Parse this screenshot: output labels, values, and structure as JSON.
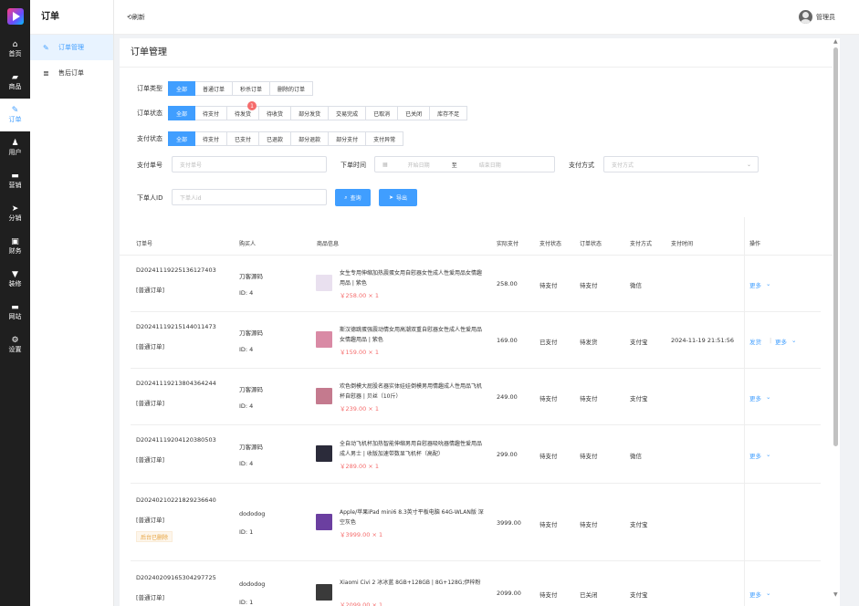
{
  "nav": {
    "items": [
      {
        "icon": "home-icon",
        "glyph": "⌂",
        "label": "首页"
      },
      {
        "icon": "shop-icon",
        "glyph": "▰",
        "label": "商品"
      },
      {
        "icon": "order-icon",
        "glyph": "✎",
        "label": "订单"
      },
      {
        "icon": "user-icon",
        "glyph": "♟",
        "label": "用户"
      },
      {
        "icon": "marketing-icon",
        "glyph": "▬",
        "label": "营销"
      },
      {
        "icon": "distribution-icon",
        "glyph": "➤",
        "label": "分销"
      },
      {
        "icon": "finance-icon",
        "glyph": "▣",
        "label": "财务"
      },
      {
        "icon": "decorate-icon",
        "glyph": "▼",
        "label": "装修"
      },
      {
        "icon": "website-icon",
        "glyph": "▬",
        "label": "网站"
      },
      {
        "icon": "settings-icon",
        "glyph": "⚙",
        "label": "设置"
      }
    ],
    "active_index": 2
  },
  "submenu": {
    "title": "订单",
    "items": [
      {
        "icon": "edit-icon",
        "glyph": "✎",
        "label": "订单管理"
      },
      {
        "icon": "list-icon",
        "glyph": "≣",
        "label": "售后订单"
      }
    ]
  },
  "header": {
    "refresh": "⟲刷新",
    "user_name": "管理员"
  },
  "page": {
    "title": "订单管理"
  },
  "filters": {
    "order_type_label": "订单类型",
    "order_type_options": [
      "全部",
      "普通订单",
      "秒杀订单",
      "删除的订单"
    ],
    "order_status_label": "订单状态",
    "order_status_options": [
      "全部",
      "待支付",
      "待发货",
      "待收货",
      "部分发货",
      "交易完成",
      "已取消",
      "已关闭",
      "库存不足"
    ],
    "pending_ship_badge": "1",
    "pay_status_label": "支付状态",
    "pay_status_options": [
      "全部",
      "待支付",
      "已支付",
      "已退款",
      "部分退款",
      "部分支付",
      "支付异常"
    ],
    "pay_no_label": "支付单号",
    "pay_no_placeholder": "支付单号",
    "order_time_label": "下单时间",
    "start_date_placeholder": "开始日期",
    "date_sep": "至",
    "end_date_placeholder": "结束日期",
    "pay_method_label": "支付方式",
    "pay_method_placeholder": "支付方式",
    "buyer_id_label": "下单人ID",
    "buyer_id_placeholder": "下单人id",
    "search_btn": "查询",
    "export_btn": "导出"
  },
  "table": {
    "columns": [
      "订单号",
      "购买人",
      "商品信息",
      "实际支付",
      "支付状态",
      "订单状态",
      "支付方式",
      "支付时间",
      "操作"
    ],
    "rows": [
      {
        "order_no": "D20241119225136127403",
        "type": "[普通订单]",
        "deleted": "",
        "buyer": "刀客源码",
        "buyer_id": "ID: 4",
        "product": "女生专用伸缩加热震蛋女用自慰器女性成人性爱用品女情趣用品 | 紫色",
        "price": "￥258.00 × 1",
        "paid": "258.00",
        "pay_status": "待支付",
        "order_status": "待支付",
        "pay_method": "微信",
        "pay_time": "",
        "ops": [
          "更多"
        ],
        "thumb": "#e9e0ef"
      },
      {
        "order_no": "D20241119215144011473",
        "type": "[普通订单]",
        "deleted": "",
        "buyer": "刀客源码",
        "buyer_id": "ID: 4",
        "product": "斯汉德跳蛋强震动情女用高潮双重自慰器女性成人性爱用品女情趣用品 | 紫色",
        "price": "￥159.00 × 1",
        "paid": "169.00",
        "pay_status": "已支付",
        "order_status": "待发货",
        "pay_method": "支付宝",
        "pay_time": "2024-11-19 21:51:56",
        "ops": [
          "发货",
          "更多"
        ],
        "thumb": "#d98aa5"
      },
      {
        "order_no": "D20241119213804364244",
        "type": "[普通订单]",
        "deleted": "",
        "buyer": "刀客源码",
        "buyer_id": "ID: 4",
        "product": "欢色倒模大屁股名器实体娃娃倒模男用情趣成人性用品飞机杯自慰器 | 贝丝（10斤）",
        "price": "￥239.00 × 1",
        "paid": "249.00",
        "pay_status": "待支付",
        "order_status": "待支付",
        "pay_method": "支付宝",
        "pay_time": "",
        "ops": [
          "更多"
        ],
        "thumb": "#c47a8e"
      },
      {
        "order_no": "D20241119204120380503",
        "type": "[普通订单]",
        "deleted": "",
        "buyer": "刀客源码",
        "buyer_id": "ID: 4",
        "product": "全自动飞机杯加热智能伸缩男用自慰器吸吮器情趣性爱用品成人男士 | 收版加速带数显飞机杯（高配）",
        "price": "￥289.00 × 1",
        "paid": "299.00",
        "pay_status": "待支付",
        "order_status": "待支付",
        "pay_method": "微信",
        "pay_time": "",
        "ops": [
          "更多"
        ],
        "thumb": "#2b2b3a"
      },
      {
        "order_no": "D20240210221829236640",
        "type": "[普通订单]",
        "deleted": "后台已删除",
        "buyer": "dododog",
        "buyer_id": "ID: 1",
        "product": "Apple/苹果iPad mini6 8.3英寸平板电脑 64G-WLAN版 深空灰色",
        "price": "￥3999.00 × 1",
        "paid": "3999.00",
        "pay_status": "待支付",
        "order_status": "待支付",
        "pay_method": "支付宝",
        "pay_time": "",
        "ops": [],
        "thumb": "#6b3fa0"
      },
      {
        "order_no": "D20240209165304297725",
        "type": "[普通订单]",
        "deleted": "后台已删除",
        "buyer": "dododog",
        "buyer_id": "ID: 1",
        "product": "Xiaomi Civi 2 冰冰蓝 8GB+128GB | 8G+128G;伊梓粉",
        "price": "￥2099.00 × 1",
        "paid": "2099.00",
        "pay_status": "待支付",
        "order_status": "已关闭",
        "pay_method": "支付宝",
        "pay_time": "",
        "ops": [
          "更多"
        ],
        "thumb": "#3a3a3a"
      }
    ]
  },
  "colors": {
    "accent": "#409eff",
    "price": "#f56c6c",
    "rail": "#1f1f1f",
    "deleted_tag": "#e6a23c"
  }
}
